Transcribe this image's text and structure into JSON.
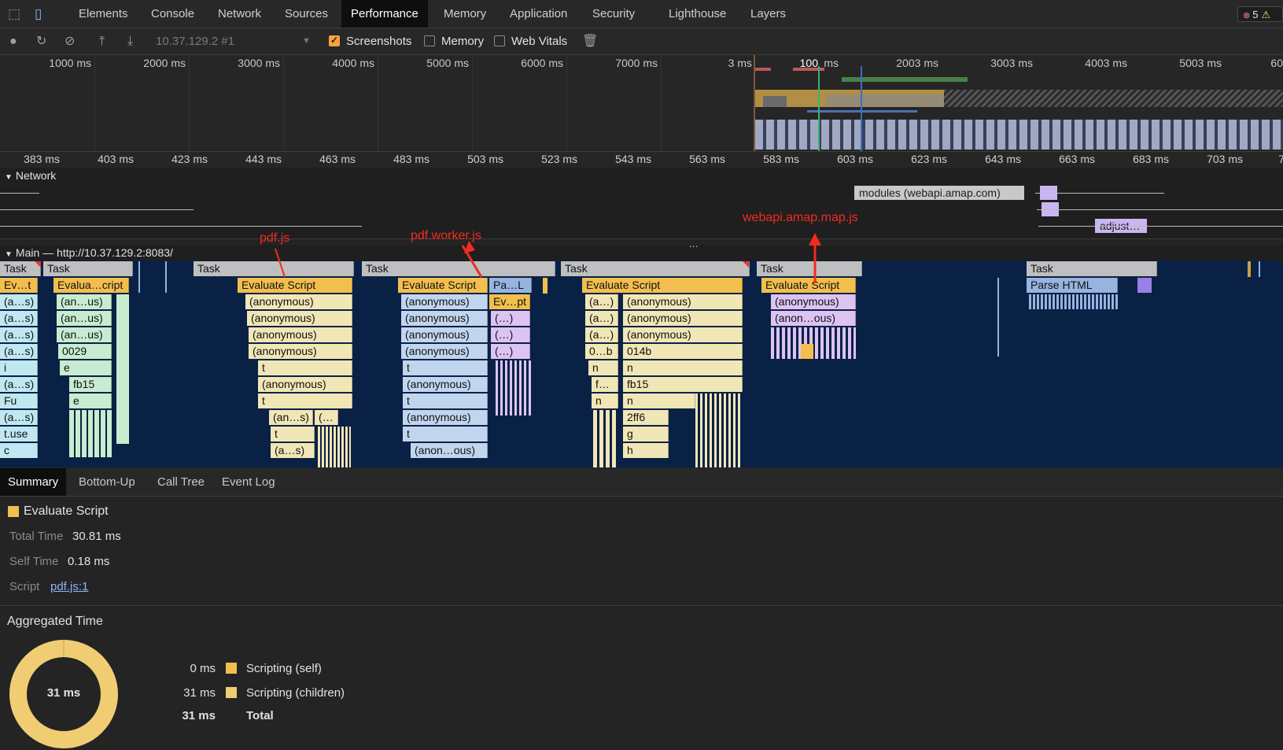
{
  "tabs": [
    {
      "label": "Elements"
    },
    {
      "label": "Console"
    },
    {
      "label": "Network"
    },
    {
      "label": "Sources"
    },
    {
      "label": "Performance"
    },
    {
      "label": "Memory"
    },
    {
      "label": "Application"
    },
    {
      "label": "Security"
    },
    {
      "label": "Lighthouse"
    },
    {
      "label": "Layers"
    }
  ],
  "active_tab": "Performance",
  "error_badge": {
    "count": "5",
    "warn": "⚠"
  },
  "toolbar": {
    "recording_target": "10.37.129.2 #1",
    "screenshots_label": "Screenshots",
    "screenshots_checked": true,
    "memory_label": "Memory",
    "memory_checked": false,
    "webvitals_label": "Web Vitals",
    "webvitals_checked": false
  },
  "overview_ticks": [
    "1000 ms",
    "2000 ms",
    "3000 ms",
    "4000 ms",
    "5000 ms",
    "6000 ms",
    "7000 ms",
    "3 ms",
    "100",
    "ms",
    "2003 ms",
    "3003 ms",
    "4003 ms",
    "5003 ms",
    "60"
  ],
  "ruler_ticks": [
    "383 ms",
    "403 ms",
    "423 ms",
    "443 ms",
    "463 ms",
    "483 ms",
    "503 ms",
    "523 ms",
    "543 ms",
    "563 ms",
    "583 ms",
    "603 ms",
    "623 ms",
    "643 ms",
    "663 ms",
    "683 ms",
    "703 ms",
    "7"
  ],
  "network": {
    "heading": "Network",
    "bar1": "modules (webapi.amap.com)",
    "bar2": "adjust…"
  },
  "main": {
    "heading": "Main — http://10.37.129.2:8083/",
    "ellipsis": "..."
  },
  "flame": {
    "task": "Task",
    "col1": [
      "Ev…t",
      "(a…s)",
      "(a…s)",
      "(a…s)",
      "(a…s)",
      "i",
      "(a…s)",
      "Fu",
      "(a…s)",
      "t.use",
      "c"
    ],
    "col2": [
      "Evalua…cript",
      "(an…us)",
      "(an…us)",
      "(an…us)",
      "0029",
      "e",
      "fb15",
      "e"
    ],
    "col3": [
      "Evaluate Script",
      "(anonymous)",
      "(anonymous)",
      "(anonymous)",
      "(anonymous)",
      "t",
      "(anonymous)",
      "t",
      "(an…s)",
      "(…",
      "t",
      "(a…s)"
    ],
    "col4": [
      "Evaluate Script",
      "(anonymous)",
      "(anonymous)",
      "(anonymous)",
      "(anonymous)",
      "t",
      "(anonymous)",
      "t",
      "(anonymous)",
      "t",
      "(anon…ous)"
    ],
    "col4b": [
      "Pa…L",
      "Ev…pt",
      "(…)",
      "(…)",
      "(…)"
    ],
    "col5a": [
      "(a…)",
      "(a…)",
      "(a…)",
      "0…b",
      "n",
      "f…",
      "n"
    ],
    "col5": [
      "Evaluate Script",
      "(anonymous)",
      "(anonymous)",
      "(anonymous)",
      "014b",
      "n",
      "fb15",
      "n",
      "2ff6",
      "g",
      "h"
    ],
    "col6": [
      "Evaluate Script",
      "(anonymous)",
      "(anon…ous)"
    ],
    "col7": [
      "Parse HTML"
    ]
  },
  "annotations": {
    "a1": "pdf.js",
    "a2": "pdf.worker.js",
    "a3": "webapi.amap.map.js"
  },
  "bottom_tabs": [
    {
      "label": "Summary"
    },
    {
      "label": "Bottom-Up"
    },
    {
      "label": "Call Tree"
    },
    {
      "label": "Event Log"
    }
  ],
  "summary": {
    "title": "Evaluate Script",
    "total_time_key": "Total Time",
    "total_time": "30.81 ms",
    "self_time_key": "Self Time",
    "self_time": "0.18 ms",
    "script_key": "Script",
    "script_link": "pdf.js:1",
    "aggregated_heading": "Aggregated Time",
    "donut_label": "31 ms",
    "legend": [
      {
        "value": "0 ms",
        "label": "Scripting (self)"
      },
      {
        "value": "31 ms",
        "label": "Scripting (children)"
      },
      {
        "value": "31 ms",
        "label": "Total"
      }
    ]
  },
  "colors": {
    "accent": "#f9a13b",
    "evaluate": "#f2bf4e",
    "flame_bg": "#0a2146",
    "annotation": "#f22b1f"
  }
}
